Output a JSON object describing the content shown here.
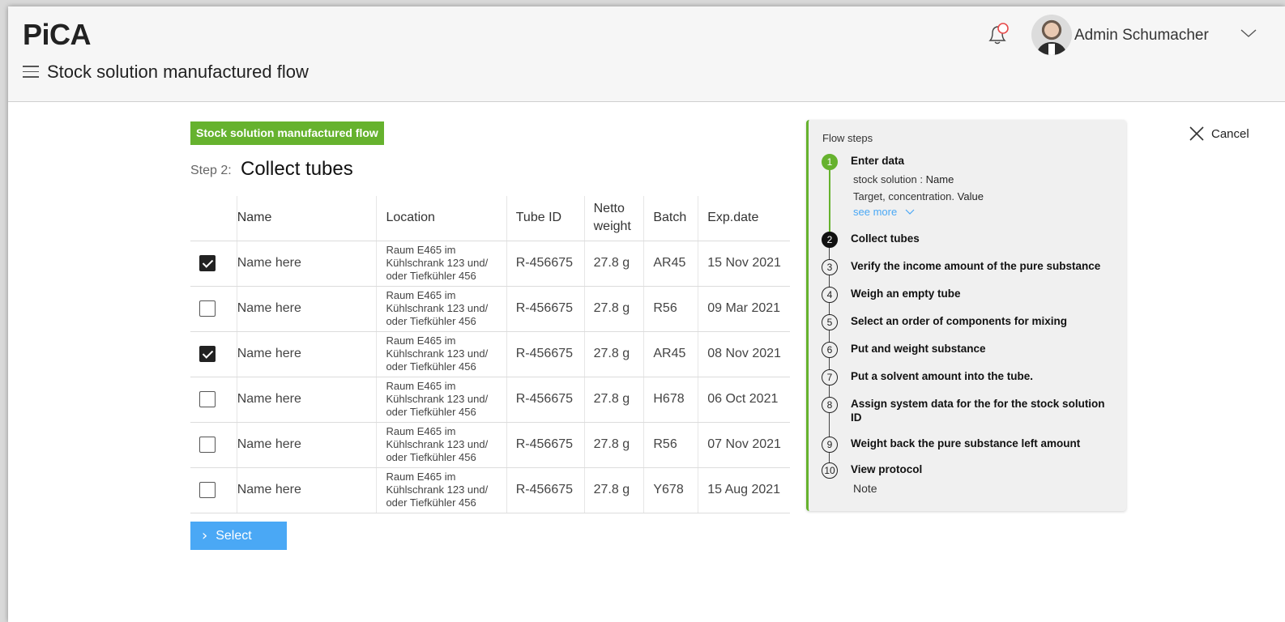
{
  "app": {
    "logo": "PiCA"
  },
  "header": {
    "page_title": "Stock solution manufactured flow",
    "user_name": "Admin Schumacher"
  },
  "flow": {
    "badge": "Stock solution manufactured flow",
    "step_prefix": "Step 2:",
    "step_title": "Collect tubes"
  },
  "table": {
    "columns": [
      "Name",
      "Location",
      "Tube ID",
      "Netto weight",
      "Batch",
      "Exp.date"
    ],
    "rows": [
      {
        "checked": true,
        "name": "Name here",
        "location": "Raum E465 im Kühlschrank 123 und/ oder Tiefkühler 456",
        "tube_id": "R-456675",
        "weight": "27.8 g",
        "batch": "AR45",
        "exp": "15 Nov 2021"
      },
      {
        "checked": false,
        "name": "Name here",
        "location": "Raum E465 im Kühlschrank 123 und/ oder Tiefkühler 456",
        "tube_id": "R-456675",
        "weight": "27.8 g",
        "batch": "R56",
        "exp": "09 Mar 2021"
      },
      {
        "checked": true,
        "name": "Name here",
        "location": "Raum E465 im Kühlschrank 123 und/ oder Tiefkühler 456",
        "tube_id": "R-456675",
        "weight": "27.8 g",
        "batch": "AR45",
        "exp": "08 Nov 2021"
      },
      {
        "checked": false,
        "name": "Name here",
        "location": "Raum E465 im Kühlschrank 123 und/ oder Tiefkühler 456",
        "tube_id": "R-456675",
        "weight": "27.8 g",
        "batch": "H678",
        "exp": "06 Oct 2021"
      },
      {
        "checked": false,
        "name": "Name here",
        "location": "Raum E465 im Kühlschrank 123 und/ oder Tiefkühler 456",
        "tube_id": "R-456675",
        "weight": "27.8 g",
        "batch": "R56",
        "exp": "07 Nov 2021"
      },
      {
        "checked": false,
        "name": "Name here",
        "location": "Raum E465 im Kühlschrank 123 und/ oder Tiefkühler 456",
        "tube_id": "R-456675",
        "weight": "27.8 g",
        "batch": "Y678",
        "exp": "15 Aug 2021"
      }
    ]
  },
  "select_button": {
    "label": "Select"
  },
  "cancel": {
    "label": "Cancel"
  },
  "steps_panel": {
    "heading": "Flow steps",
    "step1_details": {
      "stock_label": "stock solution :",
      "stock_value": "Name",
      "target_label": "Target, concentration.",
      "target_value": "Value",
      "see_more": "see more"
    },
    "step10_note": "Note",
    "steps": [
      {
        "num": "1",
        "label": "Enter data"
      },
      {
        "num": "2",
        "label": "Collect tubes"
      },
      {
        "num": "3",
        "label": "Verify the income amount of the pure substance"
      },
      {
        "num": "4",
        "label": "Weigh an empty tube"
      },
      {
        "num": "5",
        "label": "Select an order of components for mixing"
      },
      {
        "num": "6",
        "label": "Put and weight substance"
      },
      {
        "num": "7",
        "label": "Put a solvent amount into the tube."
      },
      {
        "num": "8",
        "label": "Assign system data for the for the stock solution ID"
      },
      {
        "num": "9",
        "label": "Weight back the pure substance left amount"
      },
      {
        "num": "10",
        "label": "View protocol"
      }
    ]
  },
  "colors": {
    "accent_green": "#66b22e",
    "accent_blue": "#4aa8f5"
  }
}
